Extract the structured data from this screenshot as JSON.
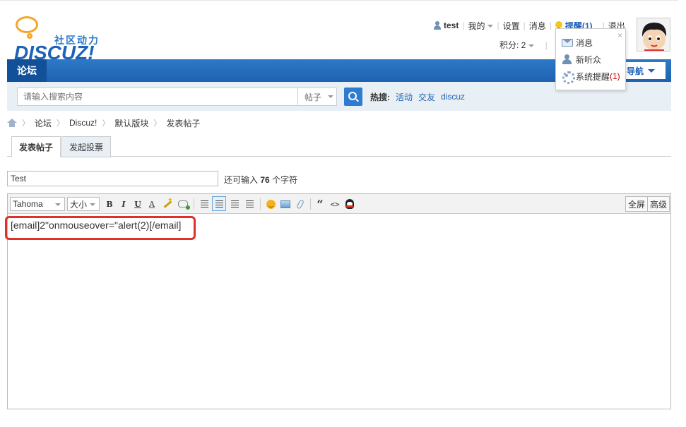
{
  "logo": {
    "cn": "社区动力",
    "en": "DISCUZ!"
  },
  "topnav": {
    "username": "test",
    "my": "我的",
    "settings": "设置",
    "messages": "消息",
    "remind": "提醒(1)",
    "logout": "退出",
    "credits": "积分: 2"
  },
  "notify_dropdown": {
    "close": "×",
    "items": [
      {
        "label": "消息",
        "icon": "mail-icon"
      },
      {
        "label": "新听众",
        "icon": "person-icon"
      },
      {
        "label": "系统提醒",
        "count": "(1)",
        "icon": "gear-icon"
      }
    ]
  },
  "navbar": {
    "home": "论坛",
    "quicknav": "导航"
  },
  "search": {
    "placeholder": "请输入搜索内容",
    "type": "帖子",
    "hot_label": "热搜:",
    "hot": [
      "活动",
      "交友",
      "discuz"
    ]
  },
  "breadcrumb": [
    "论坛",
    "Discuz!",
    "默认版块",
    "发表帖子"
  ],
  "tabs": [
    "发表帖子",
    "发起投票"
  ],
  "subject": {
    "value": "Test",
    "remaining_prefix": "还可输入",
    "remaining": "76",
    "remaining_suffix": "个字符"
  },
  "toolbar": {
    "font": "Tahoma",
    "size": "大小",
    "bold": "B",
    "italic": "I",
    "underline": "U",
    "fontcolor": "A",
    "quote": "“",
    "code": "<>",
    "fullscreen": "全屏",
    "advanced": "高级"
  },
  "editor": {
    "content": "[email]2\"onmouseover=\"alert(2)[/email]"
  },
  "colors": {
    "brand_blue": "#1f63b6",
    "highlight_red": "#e0302a",
    "nav_dark": "#13509a"
  }
}
